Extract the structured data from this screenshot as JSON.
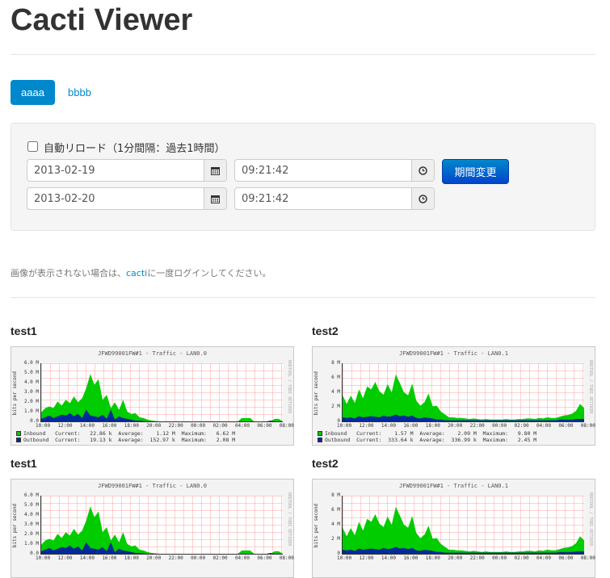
{
  "page": {
    "title": "Cacti Viewer"
  },
  "tabs": [
    {
      "label": "aaaa",
      "active": true
    },
    {
      "label": "bbbb",
      "active": false
    }
  ],
  "form": {
    "autoreload_label": "自動リロード（1分間隔：過去1時間）",
    "autoreload_checked": false,
    "start_date": "2013-02-19",
    "start_time": "09:21:42",
    "end_date": "2013-02-20",
    "end_time": "09:21:42",
    "submit_label": "期間変更"
  },
  "note": {
    "before": "画像が表示されない場合は、",
    "link": "cacti",
    "after": "に一度ログインしてください。"
  },
  "colors": {
    "accent": "#0088cc",
    "inbound": "#00cc00",
    "outbound": "#002a97"
  },
  "graphs": [
    {
      "title": "test1",
      "graph_title": "JFWD99001FW#1 - Traffic - LAN0.0",
      "ylabel": "bits per second",
      "side_text": "RRDTOOL / TOBI OETIKER",
      "yticks": [
        "6.0 M",
        "5.0 M",
        "4.0 M",
        "3.0 M",
        "2.0 M",
        "1.0 M",
        "0.0"
      ],
      "ymax": 7,
      "xticks": [
        "10:00",
        "12:00",
        "14:00",
        "16:00",
        "18:00",
        "20:00",
        "22:00",
        "00:00",
        "02:00",
        "04:00",
        "06:00",
        "08:00"
      ],
      "legend": [
        {
          "name": "Inbound",
          "current": "22.86 k",
          "average": "1.12 M",
          "maximum": "6.62 M"
        },
        {
          "name": "Outbound",
          "current": "19.13 k",
          "average": "152.97 k",
          "maximum": "2.08 M"
        }
      ],
      "inbound": [
        1.1,
        1.6,
        1.8,
        1.6,
        2.4,
        1.9,
        2.6,
        2.2,
        3.0,
        2.3,
        2.8,
        4.0,
        5.7,
        4.4,
        5.1,
        2.6,
        3.2,
        1.6,
        2.3,
        1.4,
        2.6,
        1.2,
        0.9,
        1.0,
        0.5,
        0.4,
        0.2,
        0.1,
        0.05,
        0,
        0,
        0,
        0,
        0,
        0,
        0,
        0,
        0,
        0,
        0,
        0,
        0,
        0,
        0,
        0,
        0,
        0,
        0,
        0,
        0.4,
        0.4,
        0.4,
        0,
        0,
        0,
        0,
        0,
        0.3,
        0.3,
        0
      ],
      "outbound": [
        0.3,
        0.5,
        0.7,
        0.4,
        0.6,
        0.8,
        0.7,
        1.0,
        0.6,
        0.9,
        0.4,
        1.4,
        0.7,
        0.6,
        0.5,
        0.8,
        0.3,
        1.4,
        0.2,
        0.6,
        0.4,
        0.3,
        0.2,
        0.1,
        0.1,
        0.05,
        0,
        0,
        0,
        0,
        0,
        0,
        0,
        0,
        0,
        0,
        0,
        0,
        0,
        0,
        0,
        0,
        0,
        0,
        0,
        0,
        0,
        0,
        0,
        0,
        0,
        0,
        0,
        0,
        0,
        0,
        0.1,
        0,
        0,
        0
      ]
    },
    {
      "title": "test2",
      "graph_title": "JFWD99001FW#1 - Traffic - LAN0.1",
      "ylabel": "bits per second",
      "side_text": "RRDTOOL / TOBI OETIKER",
      "yticks": [
        "8 M",
        "6 M",
        "4 M",
        "2 M",
        "0"
      ],
      "ymax": 10,
      "xticks": [
        "10:00",
        "12:00",
        "14:00",
        "16:00",
        "18:00",
        "20:00",
        "22:00",
        "00:00",
        "02:00",
        "04:00",
        "06:00",
        "08:00"
      ],
      "legend": [
        {
          "name": "Inbound",
          "current": "1.57 M",
          "average": "2.09 M",
          "maximum": "9.80 M"
        },
        {
          "name": "Outbound",
          "current": "333.64 k",
          "average": "336.99 k",
          "maximum": "2.45 M"
        }
      ],
      "inbound": [
        4.5,
        3.0,
        4.4,
        3.2,
        5.5,
        4.0,
        6.0,
        5.5,
        6.8,
        5.2,
        4.6,
        6.4,
        5.0,
        8.1,
        6.6,
        5.0,
        4.5,
        6.5,
        3.6,
        2.7,
        3.3,
        4.8,
        2.6,
        2.7,
        1.7,
        1.2,
        0.7,
        0.7,
        0.6,
        0.6,
        0.5,
        0.4,
        0.5,
        0.4,
        0.3,
        0.4,
        0.3,
        0.3,
        0.3,
        0.3,
        0.4,
        0.3,
        0.3,
        0.4,
        0.4,
        0.5,
        0.5,
        0.4,
        0.6,
        0.5,
        0.7,
        0.6,
        0.6,
        0.8,
        1.0,
        1.1,
        1.3,
        1.8,
        3.0,
        2.3
      ],
      "outbound": [
        0.7,
        0.6,
        0.7,
        0.5,
        0.9,
        0.7,
        0.8,
        0.9,
        0.8,
        0.7,
        1.0,
        0.8,
        0.9,
        1.2,
        0.9,
        1.0,
        0.8,
        1.0,
        0.6,
        0.5,
        0.7,
        0.6,
        0.5,
        0.3,
        0.3,
        0.2,
        0.2,
        0.2,
        0.2,
        0.2,
        0.2,
        0.2,
        0.2,
        0.2,
        0.2,
        0.2,
        0.2,
        0.2,
        0.2,
        0.2,
        0.2,
        0.2,
        0.2,
        0.2,
        0.2,
        0.2,
        0.2,
        0.2,
        0.2,
        0.2,
        0.2,
        0.2,
        0.2,
        0.3,
        0.3,
        0.3,
        0.3,
        0.4,
        0.4,
        0.4
      ]
    },
    {
      "title": "test1",
      "graph_title": "JFWD99001FW#1 - Traffic - LAN0.0",
      "ylabel": "bits per second",
      "side_text": "RRDTOOL / TOBI OETIKER",
      "yticks": [
        "6.0 M",
        "5.0 M",
        "4.0 M",
        "3.0 M",
        "2.0 M",
        "1.0 M",
        "0.0"
      ],
      "ymax": 7,
      "xticks": [
        "10:00",
        "12:00",
        "14:00",
        "16:00",
        "18:00",
        "20:00",
        "22:00",
        "00:00",
        "02:00",
        "04:00",
        "06:00",
        "08:00"
      ],
      "legend": [],
      "inbound": [
        1.1,
        1.6,
        1.8,
        1.6,
        2.4,
        1.9,
        2.6,
        2.2,
        3.0,
        2.3,
        2.8,
        4.0,
        5.7,
        4.4,
        5.1,
        2.6,
        3.2,
        1.6,
        2.3,
        1.4,
        2.6,
        1.2,
        0.9,
        1.0,
        0.5,
        0.4,
        0.2,
        0.1,
        0.05,
        0,
        0,
        0,
        0,
        0,
        0,
        0,
        0,
        0,
        0,
        0,
        0,
        0,
        0,
        0,
        0,
        0,
        0,
        0,
        0,
        0.4,
        0.4,
        0.4,
        0,
        0,
        0,
        0,
        0,
        0.3,
        0.3,
        0
      ],
      "outbound": [
        0.3,
        0.5,
        0.7,
        0.4,
        0.6,
        0.8,
        0.7,
        1.0,
        0.6,
        0.9,
        0.4,
        1.4,
        0.7,
        0.6,
        0.5,
        0.8,
        0.3,
        1.4,
        0.2,
        0.6,
        0.4,
        0.3,
        0.2,
        0.1,
        0.1,
        0.05,
        0,
        0,
        0,
        0,
        0,
        0,
        0,
        0,
        0,
        0,
        0,
        0,
        0,
        0,
        0,
        0,
        0,
        0,
        0,
        0,
        0,
        0,
        0,
        0,
        0,
        0,
        0,
        0,
        0,
        0,
        0.1,
        0,
        0,
        0
      ]
    },
    {
      "title": "test2",
      "graph_title": "JFWD99001FW#1 - Traffic - LAN0.1",
      "ylabel": "bits per second",
      "side_text": "RRDTOOL / TOBI OETIKER",
      "yticks": [
        "8 M",
        "6 M",
        "4 M",
        "2 M",
        "0"
      ],
      "ymax": 10,
      "xticks": [
        "10:00",
        "12:00",
        "14:00",
        "16:00",
        "18:00",
        "20:00",
        "22:00",
        "00:00",
        "02:00",
        "04:00",
        "06:00",
        "08:00"
      ],
      "legend": [],
      "inbound": [
        4.5,
        3.0,
        4.4,
        3.2,
        5.5,
        4.0,
        6.0,
        5.5,
        6.8,
        5.2,
        4.6,
        6.4,
        5.0,
        8.1,
        6.6,
        5.0,
        4.5,
        6.5,
        3.6,
        2.7,
        3.3,
        4.8,
        2.6,
        2.7,
        1.7,
        1.2,
        0.7,
        0.7,
        0.6,
        0.6,
        0.5,
        0.4,
        0.5,
        0.4,
        0.3,
        0.4,
        0.3,
        0.3,
        0.3,
        0.3,
        0.4,
        0.3,
        0.3,
        0.4,
        0.4,
        0.5,
        0.5,
        0.4,
        0.6,
        0.5,
        0.7,
        0.6,
        0.6,
        0.8,
        1.0,
        1.1,
        1.3,
        1.8,
        3.0,
        2.3
      ],
      "outbound": [
        0.7,
        0.6,
        0.7,
        0.5,
        0.9,
        0.7,
        0.8,
        0.9,
        0.8,
        0.7,
        1.0,
        0.8,
        0.9,
        1.2,
        0.9,
        1.0,
        0.8,
        1.0,
        0.6,
        0.5,
        0.7,
        0.6,
        0.5,
        0.3,
        0.3,
        0.2,
        0.2,
        0.2,
        0.2,
        0.2,
        0.2,
        0.2,
        0.2,
        0.2,
        0.2,
        0.2,
        0.2,
        0.2,
        0.2,
        0.2,
        0.2,
        0.2,
        0.2,
        0.2,
        0.2,
        0.2,
        0.2,
        0.2,
        0.2,
        0.2,
        0.2,
        0.2,
        0.2,
        0.3,
        0.3,
        0.3,
        0.3,
        0.4,
        0.4,
        0.4
      ]
    }
  ]
}
